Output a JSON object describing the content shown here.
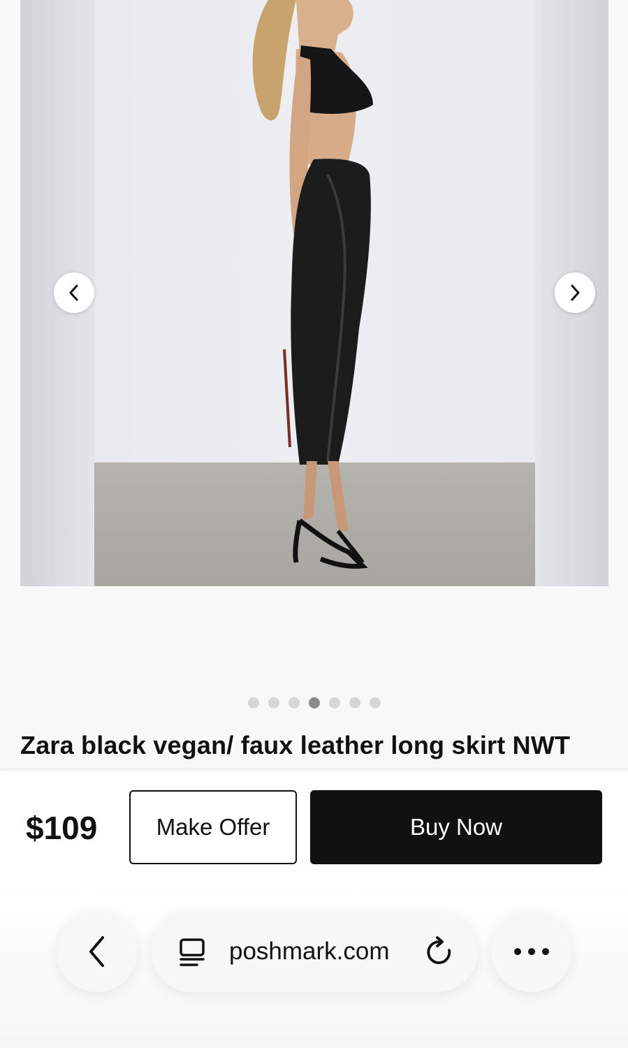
{
  "product": {
    "title": "Zara black vegan/ faux leather long skirt NWT",
    "price": "$109",
    "image_count": 7,
    "active_image_index": 3
  },
  "carousel": {
    "prev_icon": "chevron-left-icon",
    "next_icon": "chevron-right-icon"
  },
  "actions": {
    "make_offer_label": "Make Offer",
    "buy_now_label": "Buy Now"
  },
  "browser": {
    "url": "poshmark.com",
    "back_icon": "chevron-left-icon",
    "tabs_icon": "tab-overview-icon",
    "reload_icon": "reload-icon",
    "more_icon": "more-horizontal-icon"
  },
  "colors": {
    "primary_button": "#111111",
    "background": "#f8f8f8"
  }
}
